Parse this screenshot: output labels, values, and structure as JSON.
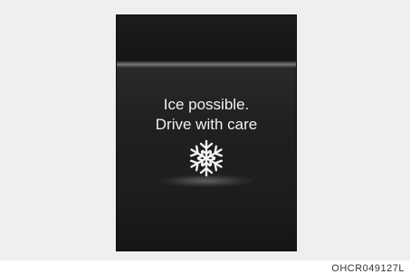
{
  "message": {
    "line1": "Ice possible.",
    "line2": "Drive with care"
  },
  "icon": "snowflake-icon",
  "figure_code": "OHCR049127L",
  "colors": {
    "display_bg": "#1e1e1e",
    "text": "#f2f2f2"
  }
}
